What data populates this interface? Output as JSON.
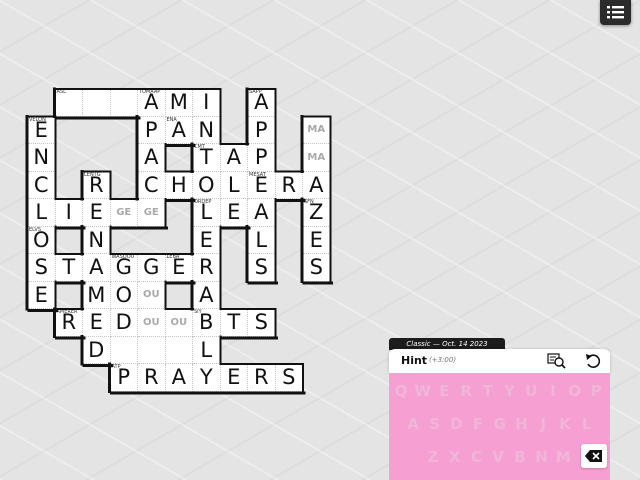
{
  "puzzle": {
    "edition_label": "Classic — Oct. 14 2023",
    "hint_label": "Hint",
    "hint_cost": "(+3:00)"
  },
  "icons": {
    "menu": "list-icon",
    "search": "magnifier-icon",
    "undo": "undo-icon",
    "backspace": "backspace-icon"
  },
  "colors": {
    "keyboard": "#f69fd2",
    "cell": "#ffffff",
    "wall": "#111111"
  },
  "cells": [
    {
      "r": 0,
      "c": 2,
      "l": "",
      "k": "ASL"
    },
    {
      "r": 0,
      "c": 3,
      "l": ""
    },
    {
      "r": 0,
      "c": 4,
      "l": ""
    },
    {
      "r": 0,
      "c": 5,
      "l": "A",
      "k": "TOMAAP"
    },
    {
      "r": 0,
      "c": 6,
      "l": "M"
    },
    {
      "r": 0,
      "c": 7,
      "l": "I"
    },
    {
      "r": 0,
      "c": 9,
      "l": "A",
      "k": "SAPP"
    },
    {
      "r": 1,
      "c": 1,
      "l": "E",
      "k": "VELON"
    },
    {
      "r": 1,
      "c": 5,
      "l": "P"
    },
    {
      "r": 1,
      "c": 6,
      "l": "A",
      "k": "ENA"
    },
    {
      "r": 1,
      "c": 7,
      "l": "N"
    },
    {
      "r": 1,
      "c": 9,
      "l": "P"
    },
    {
      "r": 1,
      "c": 11,
      "l": "MA",
      "s": true
    },
    {
      "r": 2,
      "c": 1,
      "l": "N"
    },
    {
      "r": 2,
      "c": 5,
      "l": "A"
    },
    {
      "r": 2,
      "c": 7,
      "l": "T",
      "k": "CMT"
    },
    {
      "r": 2,
      "c": 8,
      "l": "A"
    },
    {
      "r": 2,
      "c": 9,
      "l": "P"
    },
    {
      "r": 2,
      "c": 11,
      "l": "MA",
      "s": true
    },
    {
      "r": 3,
      "c": 1,
      "l": "C"
    },
    {
      "r": 3,
      "c": 3,
      "l": "R",
      "k": "LENTG"
    },
    {
      "r": 3,
      "c": 5,
      "l": "C"
    },
    {
      "r": 3,
      "c": 6,
      "l": "H"
    },
    {
      "r": 3,
      "c": 7,
      "l": "O"
    },
    {
      "r": 3,
      "c": 8,
      "l": "L"
    },
    {
      "r": 3,
      "c": 9,
      "l": "E",
      "k": "MESAT"
    },
    {
      "r": 3,
      "c": 10,
      "l": "R"
    },
    {
      "r": 3,
      "c": 11,
      "l": "A"
    },
    {
      "r": 4,
      "c": 1,
      "l": "L"
    },
    {
      "r": 4,
      "c": 2,
      "l": "I"
    },
    {
      "r": 4,
      "c": 3,
      "l": "E"
    },
    {
      "r": 4,
      "c": 4,
      "l": "GE",
      "s": true
    },
    {
      "r": 4,
      "c": 5,
      "l": "GE",
      "s": true
    },
    {
      "r": 4,
      "c": 7,
      "l": "L",
      "k": "ORDEP"
    },
    {
      "r": 4,
      "c": 8,
      "l": "E"
    },
    {
      "r": 4,
      "c": 9,
      "l": "A"
    },
    {
      "r": 4,
      "c": 11,
      "l": "Z",
      "k": "SFN"
    },
    {
      "r": 5,
      "c": 1,
      "l": "O",
      "k": "ELVS"
    },
    {
      "r": 5,
      "c": 3,
      "l": "N"
    },
    {
      "r": 5,
      "c": 7,
      "l": "E"
    },
    {
      "r": 5,
      "c": 9,
      "l": "L"
    },
    {
      "r": 5,
      "c": 11,
      "l": "E"
    },
    {
      "r": 6,
      "c": 1,
      "l": "S"
    },
    {
      "r": 6,
      "c": 2,
      "l": "T"
    },
    {
      "r": 6,
      "c": 3,
      "l": "A"
    },
    {
      "r": 6,
      "c": 4,
      "l": "G",
      "k": "WASOOU"
    },
    {
      "r": 6,
      "c": 5,
      "l": "G"
    },
    {
      "r": 6,
      "c": 6,
      "l": "E",
      "k": "LEBA"
    },
    {
      "r": 6,
      "c": 7,
      "l": "R"
    },
    {
      "r": 6,
      "c": 9,
      "l": "S"
    },
    {
      "r": 6,
      "c": 11,
      "l": "S"
    },
    {
      "r": 7,
      "c": 1,
      "l": "E"
    },
    {
      "r": 7,
      "c": 3,
      "l": "M"
    },
    {
      "r": 7,
      "c": 4,
      "l": "O"
    },
    {
      "r": 7,
      "c": 5,
      "l": "OU",
      "s": true
    },
    {
      "r": 7,
      "c": 7,
      "l": "A"
    },
    {
      "r": 8,
      "c": 2,
      "l": "R",
      "k": "AMERER"
    },
    {
      "r": 8,
      "c": 3,
      "l": "E"
    },
    {
      "r": 8,
      "c": 4,
      "l": "D"
    },
    {
      "r": 8,
      "c": 5,
      "l": "OU",
      "s": true
    },
    {
      "r": 8,
      "c": 6,
      "l": "OU",
      "s": true
    },
    {
      "r": 8,
      "c": 7,
      "l": "B",
      "k": "SIY"
    },
    {
      "r": 8,
      "c": 8,
      "l": "T"
    },
    {
      "r": 8,
      "c": 9,
      "l": "S"
    },
    {
      "r": 9,
      "c": 3,
      "l": "D"
    },
    {
      "r": 9,
      "c": 4,
      "l": ""
    },
    {
      "r": 9,
      "c": 5,
      "l": ""
    },
    {
      "r": 9,
      "c": 6,
      "l": ""
    },
    {
      "r": 9,
      "c": 7,
      "l": "L"
    },
    {
      "r": 10,
      "c": 4,
      "l": "P",
      "k": "ATP"
    },
    {
      "r": 10,
      "c": 5,
      "l": "R"
    },
    {
      "r": 10,
      "c": 6,
      "l": "A"
    },
    {
      "r": 10,
      "c": 7,
      "l": "Y"
    },
    {
      "r": 10,
      "c": 8,
      "l": "E"
    },
    {
      "r": 10,
      "c": 9,
      "l": "R"
    },
    {
      "r": 10,
      "c": 10,
      "l": "S"
    }
  ],
  "keyboard": {
    "rows": [
      [
        "Q",
        "W",
        "E",
        "R",
        "T",
        "Y",
        "U",
        "I",
        "O",
        "P"
      ],
      [
        "A",
        "S",
        "D",
        "F",
        "G",
        "H",
        "J",
        "K",
        "L"
      ],
      [
        "Z",
        "X",
        "C",
        "V",
        "B",
        "N",
        "M"
      ]
    ]
  }
}
